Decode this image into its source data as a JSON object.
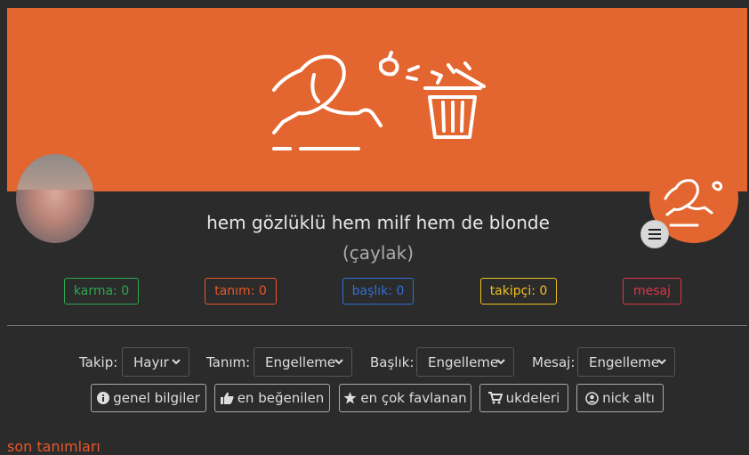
{
  "profile": {
    "nick": "hem gözlüklü hem milf hem de blonde",
    "rank": "(çaylak)"
  },
  "stats": {
    "karma": {
      "label": "karma: 0",
      "color": "#2fa84f"
    },
    "tanim": {
      "label": "tanım: 0",
      "color": "#e8572a"
    },
    "baslik": {
      "label": "başlık: 0",
      "color": "#2f6fd6"
    },
    "takipci": {
      "label": "takipçi: 0",
      "color": "#f0c020"
    },
    "mesaj": {
      "label": "mesaj",
      "color": "#dc3545"
    }
  },
  "controls": {
    "takip": {
      "label": "Takip:",
      "value": "Hayır"
    },
    "tanim": {
      "label": "Tanım:",
      "value": "Engelleme"
    },
    "baslik": {
      "label": "Başlık:",
      "value": "Engelleme"
    },
    "mesaj": {
      "label": "Mesaj:",
      "value": "Engelleme"
    }
  },
  "tabs": {
    "genel": {
      "label": "genel bilgiler",
      "icon": "info-circle-icon"
    },
    "begenilen": {
      "label": "en beğenilen",
      "icon": "thumbs-up-icon"
    },
    "favlanan": {
      "label": "en çok favlanan",
      "icon": "star-icon"
    },
    "ukdeler": {
      "label": "ukdeleri",
      "icon": "cart-icon"
    },
    "nickalti": {
      "label": "nick altı",
      "icon": "user-circle-icon"
    }
  },
  "section_title": "son tanımları",
  "colors": {
    "banner": "#e36630",
    "background": "#2b2b2b"
  }
}
